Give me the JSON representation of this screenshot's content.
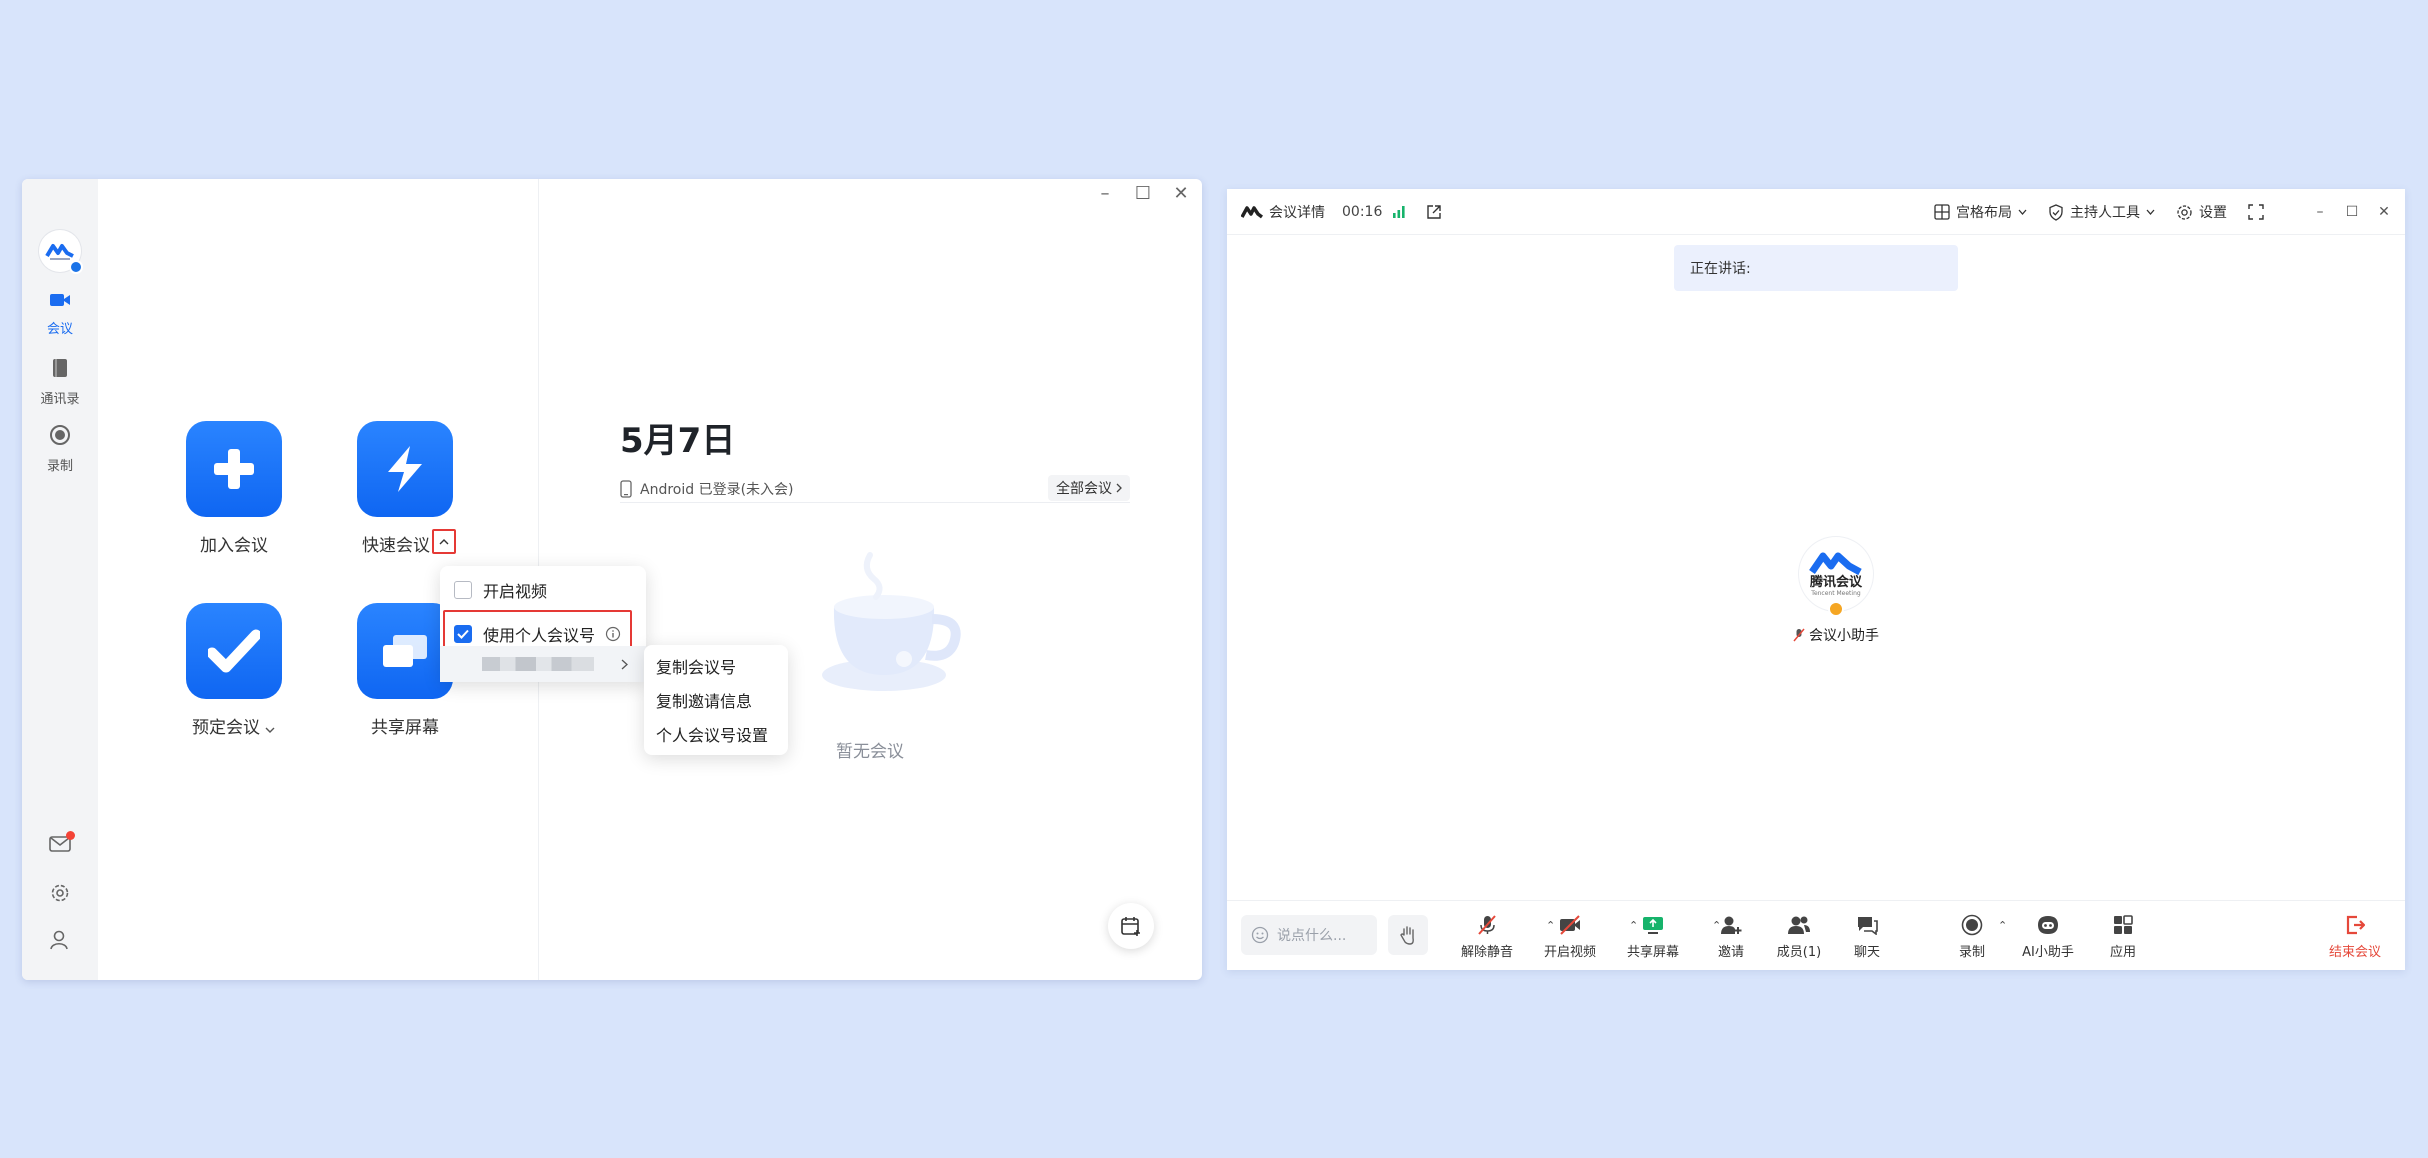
{
  "left_window": {
    "sidebar": {
      "items": [
        {
          "label": "会议",
          "icon": "video-camera-icon",
          "active": true
        },
        {
          "label": "通讯录",
          "icon": "contacts-book-icon",
          "active": false
        },
        {
          "label": "录制",
          "icon": "record-icon",
          "active": false
        }
      ],
      "bottom_icons": [
        "mail-icon",
        "settings-gear-icon",
        "user-profile-icon"
      ]
    },
    "actions": {
      "join": "加入会议",
      "quick": "快速会议",
      "schedule": "预定会议",
      "share": "共享屏幕"
    },
    "quick_menu": {
      "open_video": "开启视频",
      "use_personal_id": "使用个人会议号",
      "open_video_checked": false,
      "use_personal_id_checked": true
    },
    "submenu": {
      "items": [
        "复制会议号",
        "复制邀请信息",
        "个人会议号设置"
      ]
    },
    "date": "5月7日",
    "status": "Android 已登录(未入会)",
    "all_meetings": "全部会议",
    "empty": "暂无会议"
  },
  "right_window": {
    "topbar": {
      "details": "会议详情",
      "timer": "00:16",
      "layout": "宫格布局",
      "host_tools": "主持人工具",
      "settings": "设置"
    },
    "speaking_label": "正在讲话:",
    "participant": {
      "logo_text": "腾讯会议",
      "logo_subtext": "Tencent Meeting",
      "name": "会议小助手"
    },
    "chat_placeholder": "说点什么...",
    "toolbar": [
      {
        "label": "解除静音",
        "icon": "mic-muted-icon"
      },
      {
        "label": "开启视频",
        "icon": "video-off-icon"
      },
      {
        "label": "共享屏幕",
        "icon": "share-screen-icon"
      },
      {
        "label": "邀请",
        "icon": "invite-icon"
      },
      {
        "label": "成员(1)",
        "icon": "members-icon"
      },
      {
        "label": "聊天",
        "icon": "chat-icon"
      },
      {
        "label": "录制",
        "icon": "record-icon"
      },
      {
        "label": "AI小助手",
        "icon": "ai-assistant-icon"
      },
      {
        "label": "应用",
        "icon": "apps-icon"
      }
    ],
    "end_meeting": "结束会议",
    "colors": {
      "accent": "#1a6cf0",
      "danger": "#e5483a",
      "signal": "#16b36b"
    }
  }
}
